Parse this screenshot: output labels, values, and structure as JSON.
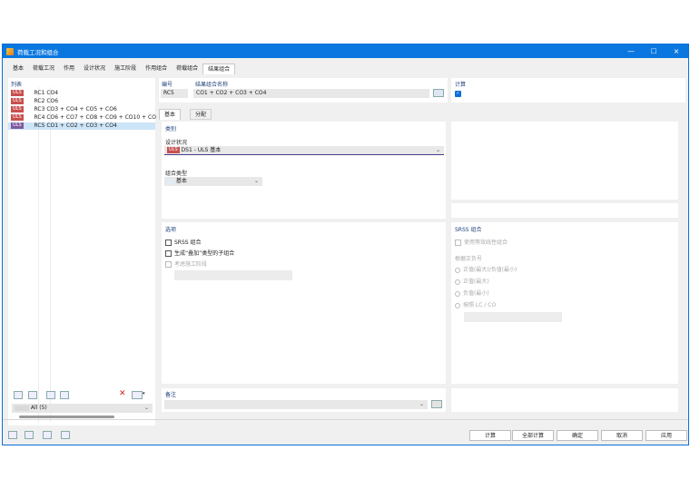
{
  "window": {
    "title": "荷载工况和组合",
    "controls": [
      "—",
      "□",
      "×"
    ]
  },
  "tabs": [
    "基本",
    "荷载工况",
    "作用",
    "设计状况",
    "施工阶段",
    "作用组合",
    "荷载组合",
    "结果组合"
  ],
  "list": {
    "header": "列表",
    "items": [
      {
        "tag": "ULS",
        "text": "RC1 CO4"
      },
      {
        "tag": "ULS",
        "text": "RC2 CO6"
      },
      {
        "tag": "ULS",
        "text": "RC3 CO3 + CO4 + CO5 + CO6"
      },
      {
        "tag": "ULS",
        "text": "RC4 CO6 + CO7 + CO8 + CO9 + CO10 + CO"
      },
      {
        "tag": "ULS",
        "text": "RC5 CO1 + CO2 + CO3 + CO4"
      }
    ],
    "filter_value": "All (5)"
  },
  "number": {
    "label": "编号",
    "value": "RC5"
  },
  "name": {
    "label": "结果组合名称",
    "value": "CO1 + CO2 + CO3 + CO4"
  },
  "calc": {
    "label": "计算"
  },
  "subtabs": [
    "基本",
    "分配"
  ],
  "category": {
    "header": "类别",
    "design_situation_label": "设计状况",
    "design_situation_tag": "ULS",
    "design_situation_value": "DS1 - ULS 基本",
    "combo_type_label": "组合类型",
    "combo_type_value": "基本"
  },
  "options": {
    "header": "选项",
    "srss": "SRSS 组合",
    "subcombo": "生成“叠加”类型的子组合",
    "construction": "考虑施工阶段"
  },
  "srss_group": {
    "header": "SRSS 组合",
    "equiv_linear": "使用等效线性组合",
    "sign_label": "根据正负号",
    "radios": [
      "正值(最大)/负值(最小)",
      "正值(最大)",
      "负值(最小)",
      "按照 LC / CO"
    ]
  },
  "comment": {
    "header": "备注"
  },
  "buttons": {
    "calc": "计算",
    "calc_all": "全部计算",
    "ok": "确定",
    "cancel": "取消",
    "apply": "应用"
  }
}
